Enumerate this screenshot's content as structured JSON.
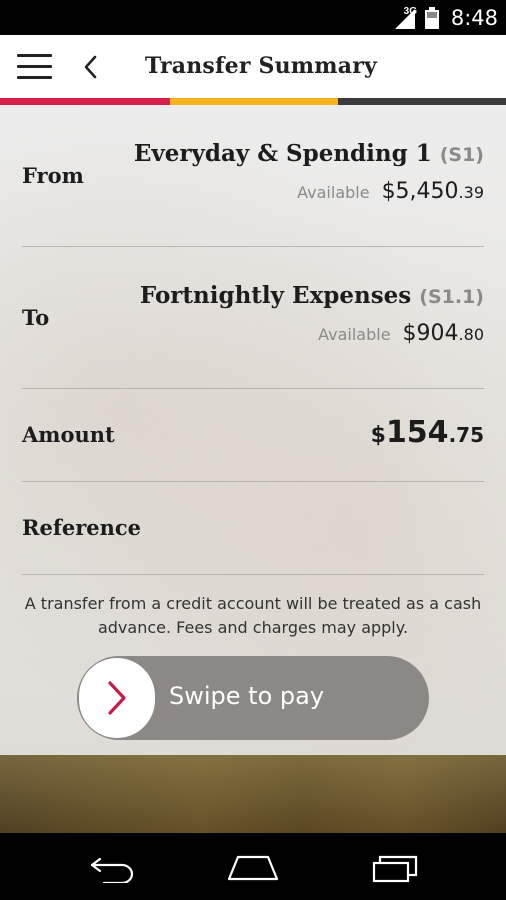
{
  "status_bar": {
    "network_type": "3G",
    "time": "8:48"
  },
  "app_bar": {
    "title": "Transfer Summary"
  },
  "colors": {
    "progress_1": "#d61f4b",
    "progress_2": "#f7b31e",
    "progress_3": "#3b3b3b",
    "swipe_chevron": "#c81a48"
  },
  "from": {
    "label": "From",
    "account_name": "Everyday & Spending 1",
    "account_code": "(S1)",
    "available_label": "Available",
    "available_dollars": "$5,450",
    "available_cents": ".39"
  },
  "to": {
    "label": "To",
    "account_name": "Fortnightly Expenses",
    "account_code": "(S1.1)",
    "available_label": "Available",
    "available_dollars": "$904",
    "available_cents": ".80"
  },
  "amount": {
    "label": "Amount",
    "currency": "$",
    "dollars": "154",
    "cents": ".75"
  },
  "reference": {
    "label": "Reference",
    "value": ""
  },
  "disclaimer": "A transfer from a credit account will be treated as a cash advance. Fees and charges may apply.",
  "swipe": {
    "label": "Swipe to pay"
  },
  "icons": {
    "menu": "hamburger-icon",
    "back": "chevron-left-icon",
    "swipe": "chevron-right-icon",
    "nav_back": "back-arrow-icon",
    "nav_home": "home-icon",
    "nav_recents": "recents-icon"
  }
}
